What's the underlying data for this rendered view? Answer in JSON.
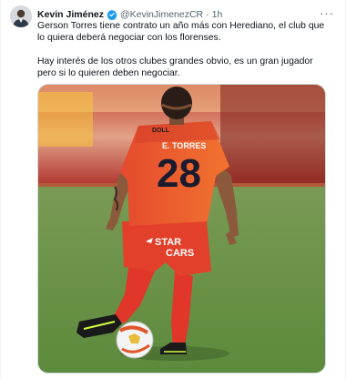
{
  "tweet": {
    "author_name": "Kevin Jiménez",
    "handle": "@KevinJimenezCR",
    "separator": "·",
    "time": "1h",
    "more_label": "···",
    "text_p1": "Gerson Torres tiene contrato un año más con Herediano, el club que lo quiera deberá negociar con los florenses.",
    "text_p2": "Hay interés de los otros clubes grandes obvio, es un gran jugador pero si lo quieren deben negociar.",
    "verified_color": "#1d9bf0",
    "player": {
      "name_on_shirt": "E. TORRES",
      "number": "28",
      "sponsor_line1": "STAR",
      "sponsor_line2": "CARS",
      "chest_label": "DOLL"
    }
  }
}
